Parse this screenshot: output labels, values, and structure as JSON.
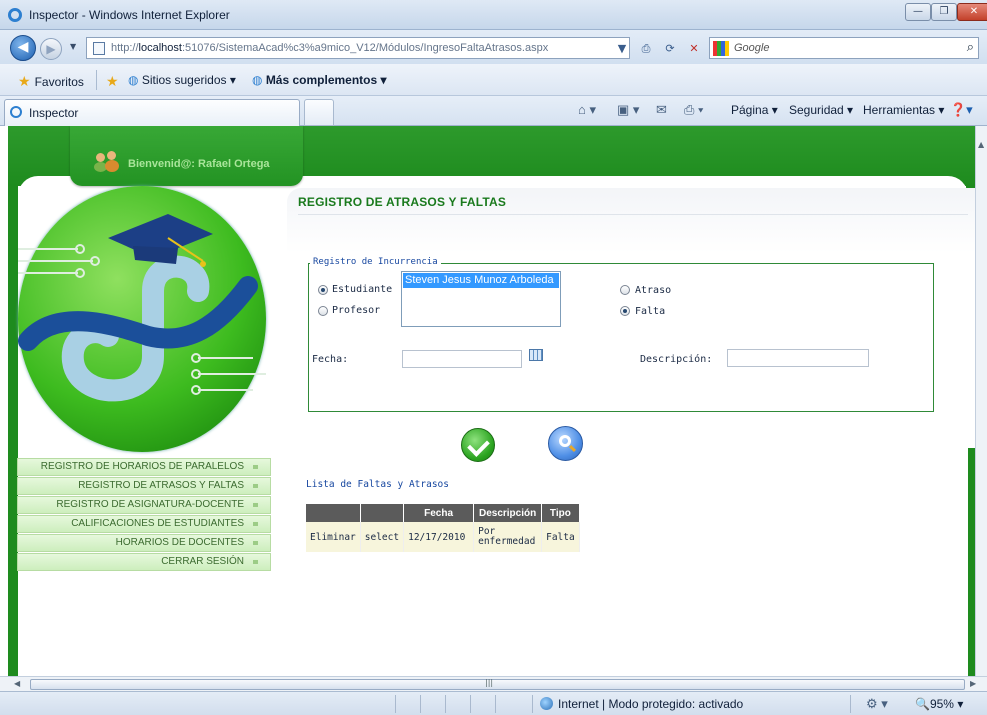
{
  "window": {
    "title": "Inspector - Windows Internet Explorer"
  },
  "address_bar": {
    "url_prefix": "http://",
    "url_host": "localhost",
    "url_rest": ":51076/SistemaAcad%c3%a9mico_V12/Módulos/IngresoFaltaAtrasos.aspx",
    "search_placeholder": "Google"
  },
  "favorites_bar": {
    "favorites": "Favoritos",
    "suggested": "Sitios sugeridos ▾",
    "addons": "Más complementos ▾"
  },
  "tab": {
    "label": "Inspector"
  },
  "command_bar": {
    "page": "Página ▾",
    "security": "Seguridad ▾",
    "tools": "Herramientas ▾"
  },
  "header": {
    "welcome": "Bienvenid@: Rafael Ortega"
  },
  "menu": {
    "items": [
      "REGISTRO DE HORARIOS DE PARALELOS",
      "REGISTRO DE ATRASOS Y FALTAS",
      "REGISTRO DE ASIGNATURA-DOCENTE",
      "CALIFICACIONES DE ESTUDIANTES",
      "HORARIOS DE DOCENTES",
      "CERRAR SESIÓN"
    ]
  },
  "page": {
    "title": "REGISTRO DE ATRASOS Y  FALTAS"
  },
  "form": {
    "legend": "Registro de Incurrencia",
    "person_type": {
      "estudiante": "Estudiante",
      "profesor": "Profesor",
      "selected": "Estudiante"
    },
    "person_list_selected": "Steven Jesus Munoz Arboleda",
    "incident_type": {
      "atraso": "Atraso",
      "falta": "Falta",
      "selected": "Falta"
    },
    "fecha_label": "Fecha:",
    "fecha_value": "",
    "descripcion_label": "Descripción:",
    "descripcion_value": ""
  },
  "list": {
    "title": "Lista de Faltas y Atrasos",
    "headers": [
      "",
      "",
      "Fecha",
      "Descripción",
      "Tipo"
    ],
    "rows": [
      {
        "delete": "Eliminar",
        "select": "select",
        "fecha": "12/17/2010",
        "descripcion_1": "Por",
        "descripcion_2": "enfermedad",
        "tipo": "Falta"
      }
    ]
  },
  "status_bar": {
    "zone": "Internet | Modo protegido: activado",
    "zoom": "95%"
  }
}
